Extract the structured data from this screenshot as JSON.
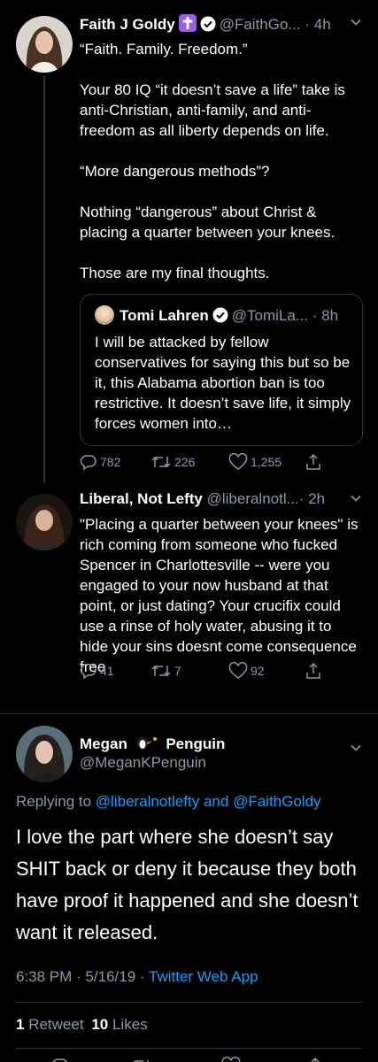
{
  "tweet1": {
    "name": "Faith J Goldy",
    "handle": "@FaithGo...",
    "sep": "·",
    "time": "4h",
    "text": "“Faith. Family. Freedom.”\n\nYour 80 IQ “it doesn’t save a life” take is anti-Christian, anti-family, and anti-freedom as all liberty depends on life.\n\n“More dangerous methods”?\n\nNothing “dangerous” about Christ & placing a quarter between your knees.\n\nThose are my final thoughts.",
    "quote": {
      "name": "Tomi Lahren",
      "handle": "@TomiLa...",
      "sep": "·",
      "time": "8h",
      "text": "I will be attacked by fellow conservatives for saying this but so be it, this Alabama abortion ban is too restrictive. It doesn’t save life, it simply forces women into…"
    },
    "actions": {
      "replies": "782",
      "retweets": "226",
      "likes": "1,255"
    }
  },
  "tweet2": {
    "name": "Liberal, Not Lefty",
    "handle": "@liberalnotl...",
    "sep": "·",
    "time": "2h",
    "text": "\"Placing a quarter between your knees\" is rich coming from someone who fucked Spencer in Charlottesville -- were you engaged to your now husband at that point, or just dating? Your crucifix could use a rinse of holy water, abusing it to hide your sins doesnt come consequence free",
    "actions": {
      "replies": "41",
      "retweets": "7",
      "likes": "92"
    }
  },
  "focus": {
    "name_a": "Megan",
    "name_b": "Penguin",
    "handle": "@MeganKPenguin",
    "replying_prefix": "Replying to",
    "replying_user1": "@liberalnotlefty",
    "replying_and": "and",
    "replying_user2": "@FaithGoldy",
    "text": "I love the part where she doesn’t say SHIT back or deny it because they both have proof it happened and she doesn’t want it released.",
    "time": "6:38 PM",
    "dot1": "·",
    "date": "5/16/19",
    "dot2": "·",
    "client": "Twitter Web App",
    "retweets_count": "1",
    "retweets_label": "Retweet",
    "likes_count": "10",
    "likes_label": "Likes"
  },
  "colors": {
    "background": "#000000",
    "text": "#ffffff",
    "secondary": "#8b98a5",
    "link": "#1d9bf0",
    "verified": "#ffffff",
    "cross_badge": "#9b5de5",
    "divider": "#2f3336"
  },
  "icons": [
    "reply-icon",
    "retweet-icon",
    "like-icon",
    "share-icon",
    "verified-icon",
    "cross-emoji-icon",
    "penguin-emoji-icon",
    "chevron-down-icon"
  ]
}
